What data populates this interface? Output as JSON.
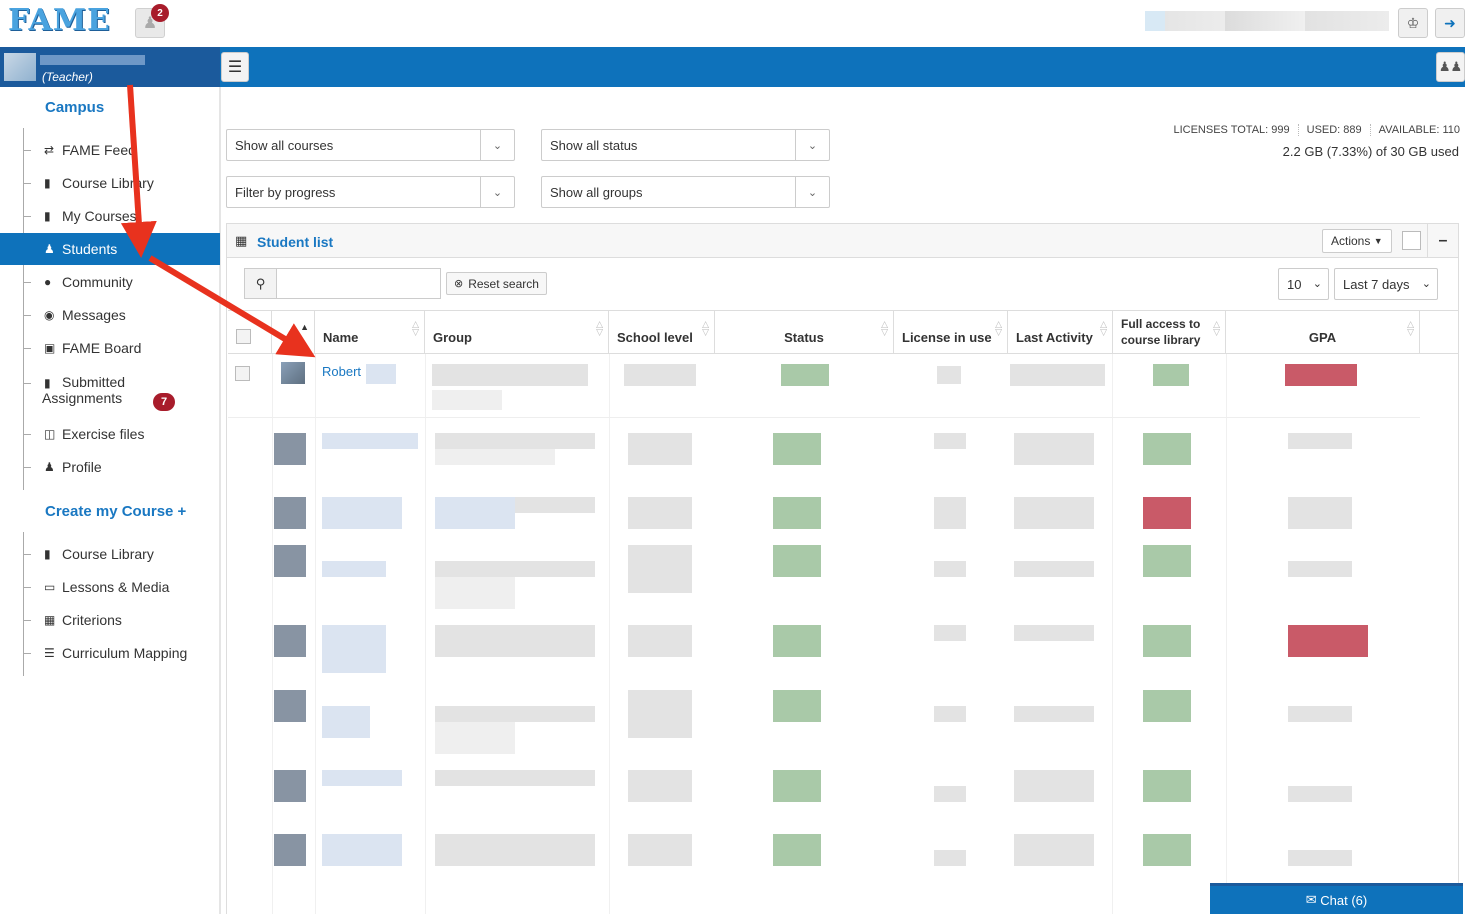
{
  "app": {
    "logo": "FAME",
    "notification_count": "2"
  },
  "user": {
    "role": "(Teacher)"
  },
  "sidebar": {
    "campus_title": "Campus",
    "campus_items": [
      {
        "label": "FAME Feed",
        "icon": "retweet-icon"
      },
      {
        "label": "Course Library",
        "icon": "book-icon"
      },
      {
        "label": "My Courses",
        "icon": "book-icon"
      },
      {
        "label": "Students",
        "icon": "users-icon",
        "active": true
      },
      {
        "label": "Community",
        "icon": "globe-icon"
      },
      {
        "label": "Messages",
        "icon": "comment-icon"
      },
      {
        "label": "FAME Board",
        "icon": "image-icon"
      },
      {
        "label_line1": "Submitted",
        "label_line2": "Assignments",
        "icon": "book-icon",
        "badge": "7"
      },
      {
        "label": "Exercise files",
        "icon": "folder-open-icon"
      },
      {
        "label": "Profile",
        "icon": "user-icon"
      }
    ],
    "create_title": "Create my Course +",
    "create_items": [
      {
        "label": "Course Library",
        "icon": "book-icon"
      },
      {
        "label": "Lessons & Media",
        "icon": "monitor-icon"
      },
      {
        "label": "Criterions",
        "icon": "table-icon"
      },
      {
        "label": "Curriculum Mapping",
        "icon": "list-icon"
      }
    ]
  },
  "filters": {
    "courses": "Show all courses",
    "status": "Show all status",
    "progress": "Filter by progress",
    "groups": "Show all groups"
  },
  "licenses": {
    "total": "LICENSES TOTAL: 999",
    "used": "USED: 889",
    "available": "AVAILABLE: 110",
    "storage": "2.2 GB (7.33%) of 30 GB used"
  },
  "panel": {
    "title": "Student list",
    "actions_label": "Actions",
    "reset_search": "Reset search",
    "page_size": "10",
    "period": "Last 7 days"
  },
  "table": {
    "columns": {
      "name": "Name",
      "group": "Group",
      "school_level": "School level",
      "status": "Status",
      "license": "License in use",
      "last_activity": "Last Activity",
      "full_access_1": "Full access to",
      "full_access_2": "course library",
      "gpa": "GPA"
    },
    "first_student": "Robert"
  },
  "chat": {
    "label": "Chat (6)"
  },
  "colors": {
    "brand_blue": "#0e72bb",
    "dark_blue": "#1b5a9c",
    "badge_red": "#a81c2b",
    "arrow_red": "#e8321e"
  }
}
